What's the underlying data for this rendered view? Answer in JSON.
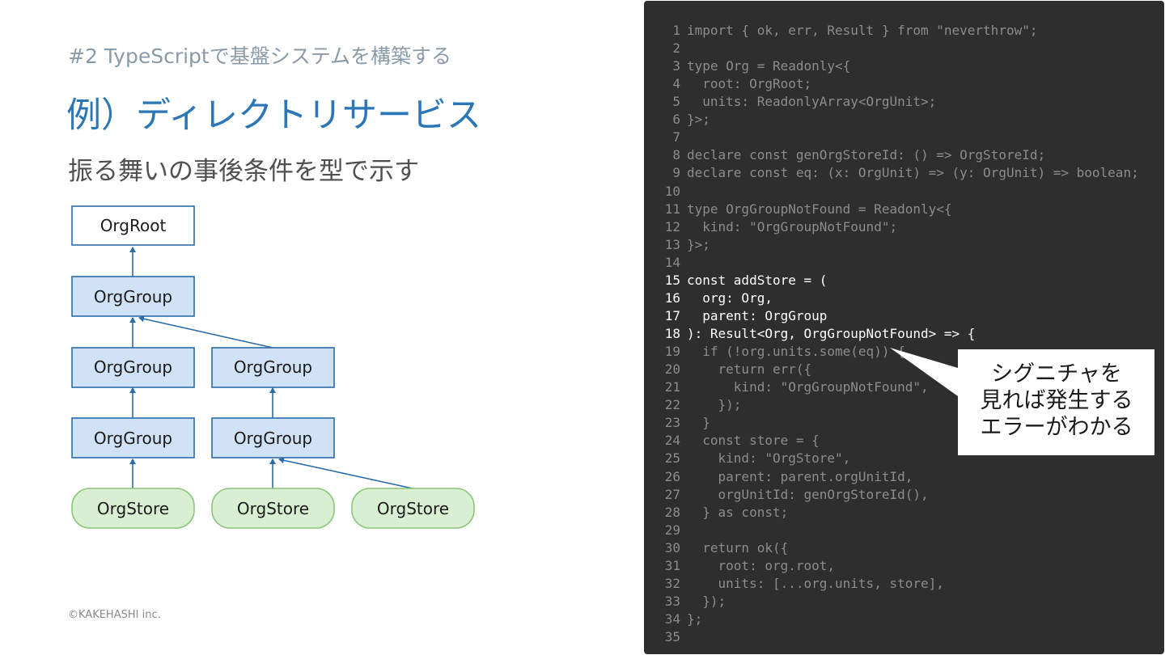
{
  "slide": {
    "subtitle": "#2 TypeScriptで基盤システムを構築する",
    "title": "例）ディレクトリサービス",
    "tagline": "振る舞いの事後条件を型で示す",
    "copyright": "©KAKEHASHI inc."
  },
  "diagram": {
    "nodes": {
      "root": "OrgRoot",
      "group_a": "OrgGroup",
      "group_b1": "OrgGroup",
      "group_b2": "OrgGroup",
      "group_c1": "OrgGroup",
      "group_c2": "OrgGroup",
      "store_1": "OrgStore",
      "store_2": "OrgStore",
      "store_3": "OrgStore"
    }
  },
  "code": {
    "lines": [
      {
        "n": "1",
        "text": "import { ok, err, Result } from \"neverthrow\";"
      },
      {
        "n": "2",
        "text": ""
      },
      {
        "n": "3",
        "text": "type Org = Readonly<{"
      },
      {
        "n": "4",
        "text": "  root: OrgRoot;"
      },
      {
        "n": "5",
        "text": "  units: ReadonlyArray<OrgUnit>;"
      },
      {
        "n": "6",
        "text": "}>;"
      },
      {
        "n": "7",
        "text": ""
      },
      {
        "n": "8",
        "text": "declare const genOrgStoreId: () => OrgStoreId;"
      },
      {
        "n": "9",
        "text": "declare const eq: (x: OrgUnit) => (y: OrgUnit) => boolean;"
      },
      {
        "n": "10",
        "text": ""
      },
      {
        "n": "11",
        "text": "type OrgGroupNotFound = Readonly<{"
      },
      {
        "n": "12",
        "text": "  kind: \"OrgGroupNotFound\";"
      },
      {
        "n": "13",
        "text": "}>;"
      },
      {
        "n": "14",
        "text": ""
      },
      {
        "n": "15",
        "text": "const addStore = ("
      },
      {
        "n": "16",
        "text": "  org: Org,"
      },
      {
        "n": "17",
        "text": "  parent: OrgGroup"
      },
      {
        "n": "18",
        "text": "): Result<Org, OrgGroupNotFound> => {"
      },
      {
        "n": "19",
        "text": "  if (!org.units.some(eq)) {"
      },
      {
        "n": "20",
        "text": "    return err({"
      },
      {
        "n": "21",
        "text": "      kind: \"OrgGroupNotFound\","
      },
      {
        "n": "22",
        "text": "    });"
      },
      {
        "n": "23",
        "text": "  }"
      },
      {
        "n": "24",
        "text": "  const store = {"
      },
      {
        "n": "25",
        "text": "    kind: \"OrgStore\","
      },
      {
        "n": "26",
        "text": "    parent: parent.orgUnitId,"
      },
      {
        "n": "27",
        "text": "    orgUnitId: genOrgStoreId(),"
      },
      {
        "n": "28",
        "text": "  } as const;"
      },
      {
        "n": "29",
        "text": ""
      },
      {
        "n": "30",
        "text": "  return ok({"
      },
      {
        "n": "31",
        "text": "    root: org.root,"
      },
      {
        "n": "32",
        "text": "    units: [...org.units, store],"
      },
      {
        "n": "33",
        "text": "  });"
      },
      {
        "n": "34",
        "text": "};"
      },
      {
        "n": "35",
        "text": ""
      }
    ],
    "highlighted_lines": [
      "15",
      "16",
      "17",
      "18"
    ]
  },
  "callout": {
    "line1": "シグニチャを",
    "line2": "見れば発生する",
    "line3": "エラーがわかる"
  },
  "colors": {
    "accent": "#2a76b6",
    "code_bg": "#2e2e2e",
    "group_fill": "#cfe2f6",
    "store_fill": "#d8efd2"
  }
}
